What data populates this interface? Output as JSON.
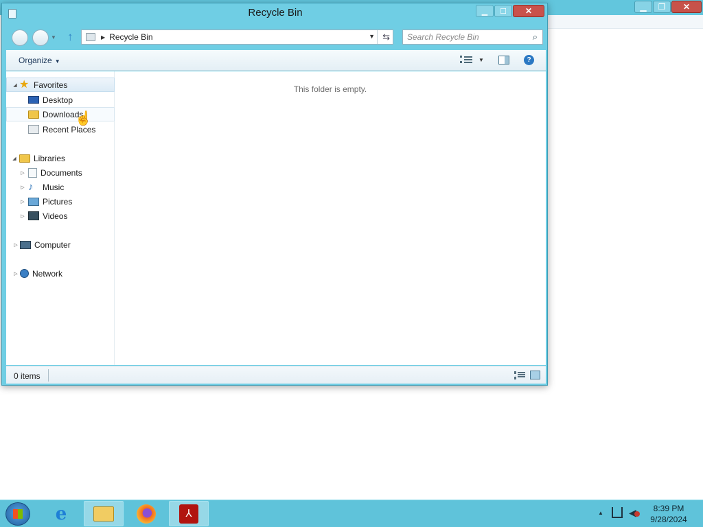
{
  "explorer": {
    "title": "Recycle Bin",
    "address": {
      "location": "Recycle Bin"
    },
    "search": {
      "placeholder": "Search Recycle Bin"
    },
    "toolbar": {
      "organize_label": "Organize"
    },
    "nav_pane": {
      "favorites": {
        "label": "Favorites",
        "items": [
          {
            "label": "Desktop",
            "icon": "desktop-icon"
          },
          {
            "label": "Downloads",
            "icon": "downloads-folder-icon"
          },
          {
            "label": "Recent Places",
            "icon": "recent-places-icon"
          }
        ]
      },
      "libraries": {
        "label": "Libraries",
        "items": [
          {
            "label": "Documents",
            "icon": "documents-icon"
          },
          {
            "label": "Music",
            "icon": "music-icon"
          },
          {
            "label": "Pictures",
            "icon": "pictures-icon"
          },
          {
            "label": "Videos",
            "icon": "videos-icon"
          }
        ]
      },
      "computer": {
        "label": "Computer"
      },
      "network": {
        "label": "Network"
      }
    },
    "content": {
      "empty_message": "This folder is empty."
    },
    "status": {
      "item_count": "0 items"
    }
  },
  "taskbar": {
    "pinned": [
      {
        "icon": "internet-explorer-icon"
      },
      {
        "icon": "file-explorer-icon",
        "active": true
      },
      {
        "icon": "firefox-icon"
      },
      {
        "icon": "acrobat-reader-icon"
      }
    ],
    "clock": {
      "time": "8:39 PM",
      "date": "9/28/2024"
    }
  },
  "colors": {
    "window_frame": "#6fcee4",
    "taskbar": "#5fc3da",
    "close_button": "#c9524b"
  }
}
